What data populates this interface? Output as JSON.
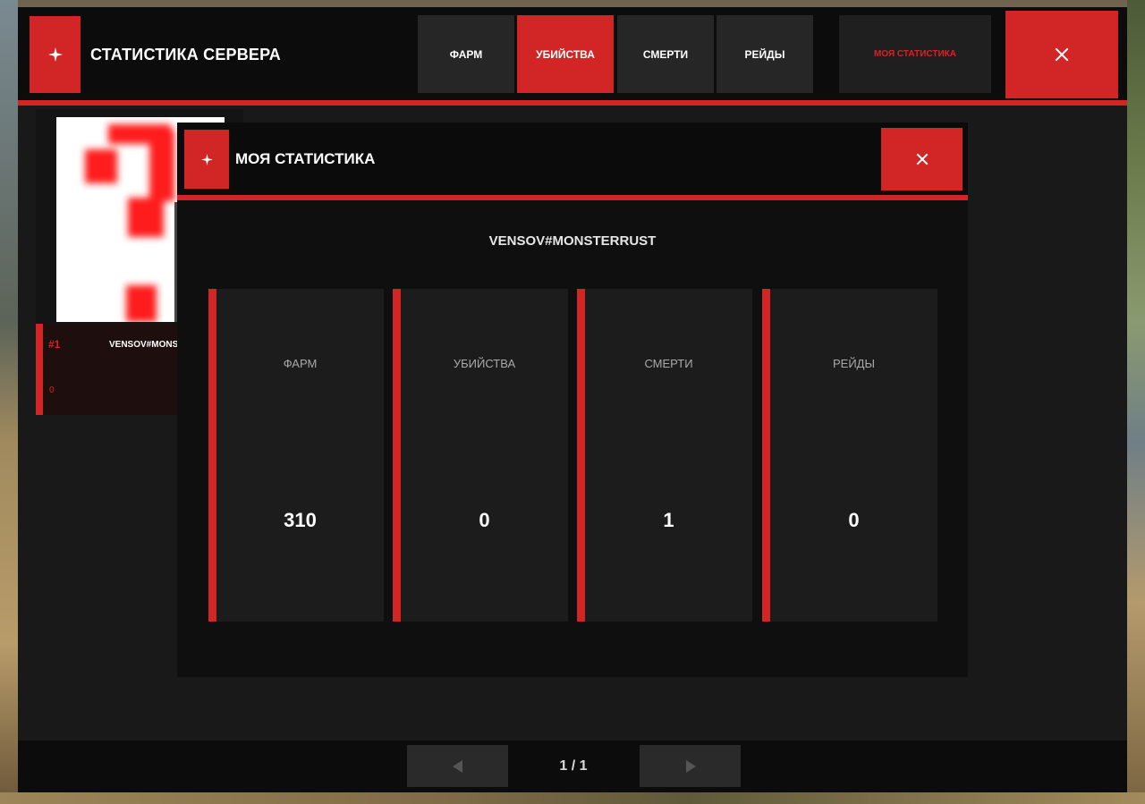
{
  "header": {
    "title": "СТАТИСТИКА СЕРВЕРА",
    "tabs": [
      {
        "label": "ФАРМ",
        "active": false
      },
      {
        "label": "УБИЙСТВА",
        "active": true
      },
      {
        "label": "СМЕРТИ",
        "active": false
      },
      {
        "label": "РЕЙДЫ",
        "active": false
      }
    ],
    "my_stats_label": "МОЯ СТАТИСТИКА",
    "logo_icon": "sparkle-icon",
    "close_icon": "close-icon"
  },
  "leaderboard": {
    "entries": [
      {
        "rank": "#1",
        "name": "VENSOV#MONSTERRUST",
        "value": "0",
        "avatar_icon": "question-mark-icon"
      }
    ]
  },
  "modal": {
    "title": "МОЯ СТАТИСТИКА",
    "player": "VENSOV#MONSTERRUST",
    "stats": [
      {
        "label": "ФАРМ",
        "value": "310"
      },
      {
        "label": "УБИЙСТВА",
        "value": "0"
      },
      {
        "label": "СМЕРТИ",
        "value": "1"
      },
      {
        "label": "РЕЙДЫ",
        "value": "0"
      }
    ]
  },
  "pagination": {
    "label": "1 / 1",
    "prev_icon": "arrow-left-icon",
    "next_icon": "arrow-right-icon"
  },
  "colors": {
    "accent": "#d22525",
    "panel": "#191919",
    "header": "#0c0c0c",
    "tab": "#262626"
  }
}
